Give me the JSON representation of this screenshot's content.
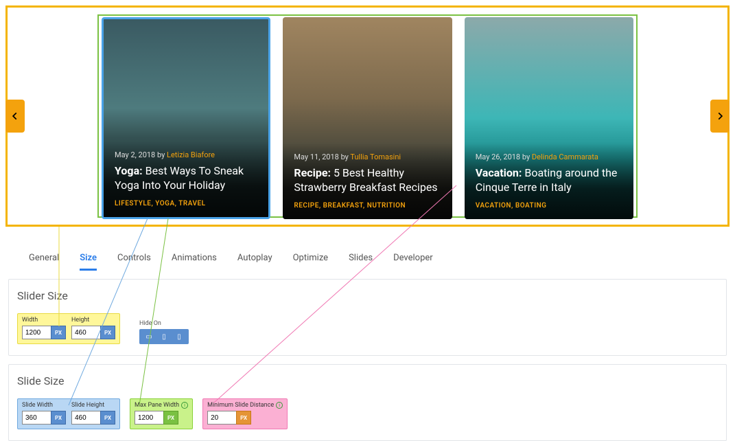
{
  "carousel": {
    "cards": [
      {
        "date": "May 2, 2018",
        "by": "by",
        "author": "Letizia Biafore",
        "title_bold": "Yoga:",
        "title_rest": " Best Ways To Sneak Yoga Into Your Holiday",
        "cats": "LIFESTYLE, YOGA, TRAVEL"
      },
      {
        "date": "May 11, 2018",
        "by": "by",
        "author": "Tullia Tomasini",
        "title_bold": "Recipe:",
        "title_rest": " 5 Best Healthy Strawberry Breakfast Recipes",
        "cats": "RECIPE, BREAKFAST, NUTRITION"
      },
      {
        "date": "May 26, 2018",
        "by": "by",
        "author": "Delinda Cammarata",
        "title_bold": "Vacation:",
        "title_rest": " Boating around the Cinque Terre in Italy",
        "cats": "VACATION, BOATING"
      }
    ]
  },
  "tabs": {
    "items": [
      "General",
      "Size",
      "Controls",
      "Animations",
      "Autoplay",
      "Optimize",
      "Slides",
      "Developer"
    ],
    "active_index": 1
  },
  "panel_slider_size": {
    "heading": "Slider Size",
    "width_label": "Width",
    "width_value": "1200",
    "height_label": "Height",
    "height_value": "460",
    "hide_on_label": "Hide On"
  },
  "panel_slide_size": {
    "heading": "Slide Size",
    "slide_width_label": "Slide Width",
    "slide_width_value": "360",
    "slide_height_label": "Slide Height",
    "slide_height_value": "460",
    "max_pane_label": "Max Pane Width",
    "max_pane_value": "1200",
    "min_dist_label": "Minimum Slide Distance",
    "min_dist_value": "20"
  },
  "units": {
    "px": "PX"
  }
}
